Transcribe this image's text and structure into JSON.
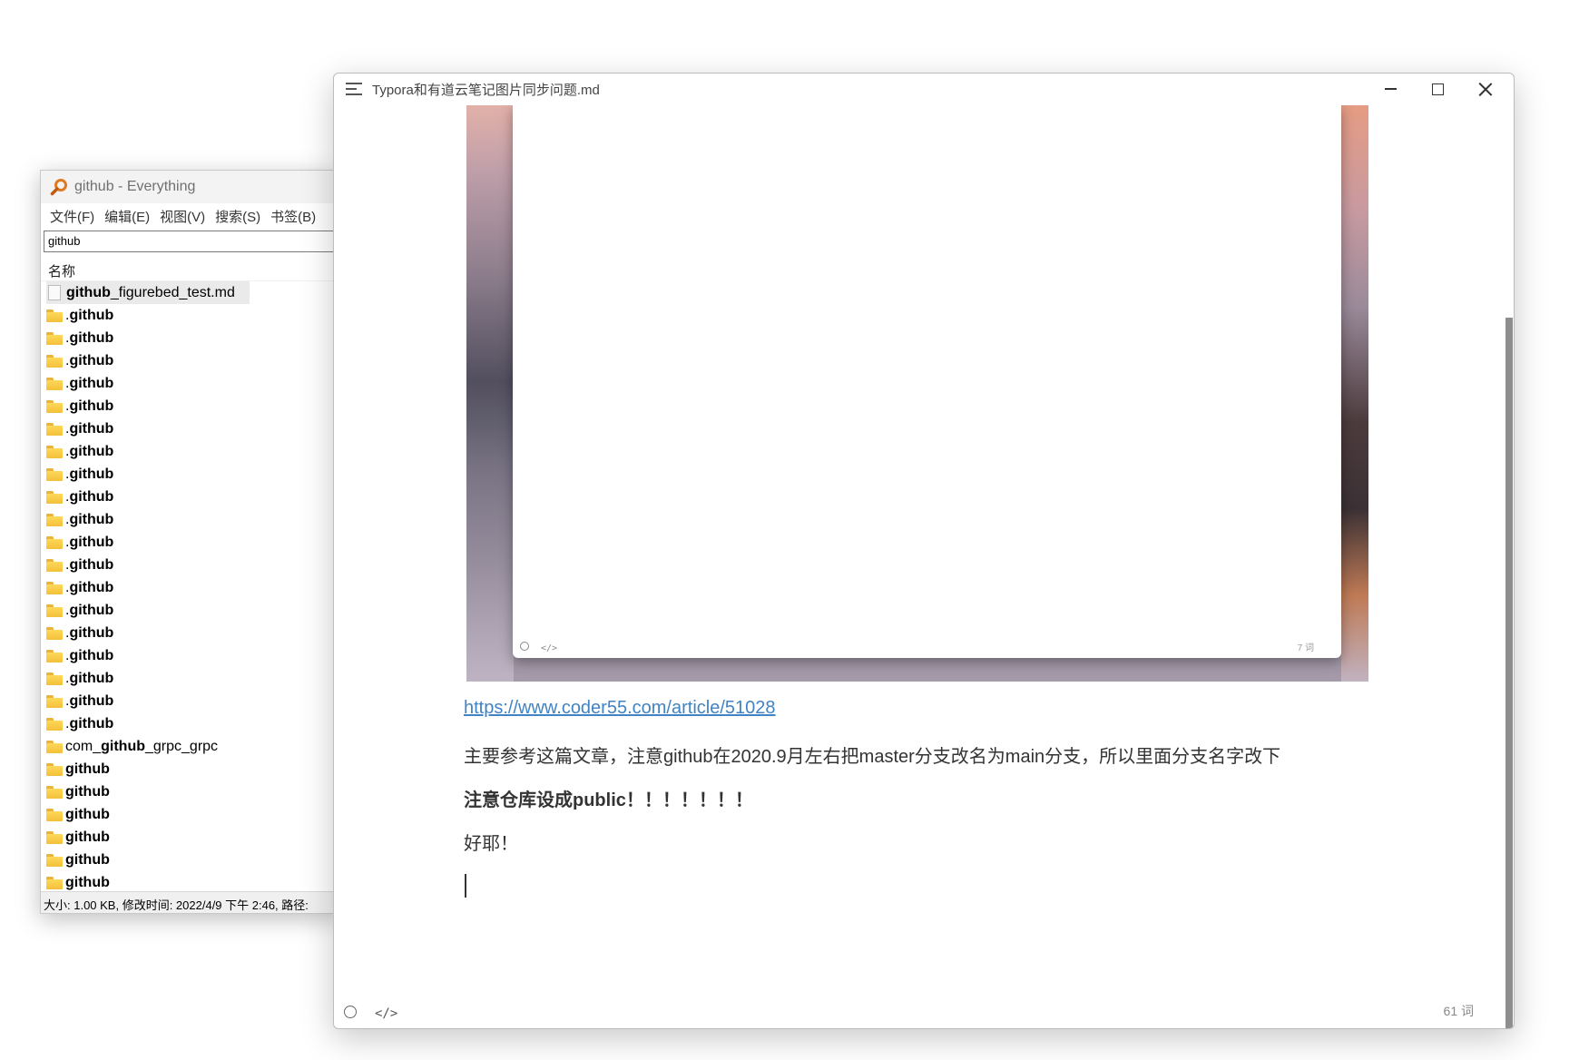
{
  "everything": {
    "title": "github - Everything",
    "menu": [
      "文件(F)",
      "编辑(E)",
      "视图(V)",
      "搜索(S)",
      "书签(B)"
    ],
    "search_value": "github",
    "column_name": "名称",
    "rows": [
      {
        "type": "md",
        "bold": "github",
        "rest": "_figurebed_test.md",
        "prefix": ""
      },
      {
        "type": "folder",
        "prefix": ".",
        "bold": "github",
        "rest": ""
      },
      {
        "type": "folder",
        "prefix": ".",
        "bold": "github",
        "rest": ""
      },
      {
        "type": "folder",
        "prefix": ".",
        "bold": "github",
        "rest": ""
      },
      {
        "type": "folder",
        "prefix": ".",
        "bold": "github",
        "rest": ""
      },
      {
        "type": "folder",
        "prefix": ".",
        "bold": "github",
        "rest": ""
      },
      {
        "type": "folder",
        "prefix": ".",
        "bold": "github",
        "rest": ""
      },
      {
        "type": "folder",
        "prefix": ".",
        "bold": "github",
        "rest": ""
      },
      {
        "type": "folder",
        "prefix": ".",
        "bold": "github",
        "rest": ""
      },
      {
        "type": "folder",
        "prefix": ".",
        "bold": "github",
        "rest": ""
      },
      {
        "type": "folder",
        "prefix": ".",
        "bold": "github",
        "rest": ""
      },
      {
        "type": "folder",
        "prefix": ".",
        "bold": "github",
        "rest": ""
      },
      {
        "type": "folder",
        "prefix": ".",
        "bold": "github",
        "rest": ""
      },
      {
        "type": "folder",
        "prefix": ".",
        "bold": "github",
        "rest": ""
      },
      {
        "type": "folder",
        "prefix": ".",
        "bold": "github",
        "rest": ""
      },
      {
        "type": "folder",
        "prefix": ".",
        "bold": "github",
        "rest": ""
      },
      {
        "type": "folder",
        "prefix": ".",
        "bold": "github",
        "rest": ""
      },
      {
        "type": "folder",
        "prefix": ".",
        "bold": "github",
        "rest": ""
      },
      {
        "type": "folder",
        "prefix": ".",
        "bold": "github",
        "rest": ""
      },
      {
        "type": "folder",
        "prefix": ".",
        "bold": "github",
        "rest": ""
      },
      {
        "type": "folder",
        "prefix": "com_",
        "bold": "github",
        "rest": "_grpc_grpc"
      },
      {
        "type": "folder",
        "prefix": "",
        "bold": "github",
        "rest": ""
      },
      {
        "type": "folder",
        "prefix": "",
        "bold": "github",
        "rest": ""
      },
      {
        "type": "folder",
        "prefix": "",
        "bold": "github",
        "rest": ""
      },
      {
        "type": "folder",
        "prefix": "",
        "bold": "github",
        "rest": ""
      },
      {
        "type": "folder",
        "prefix": "",
        "bold": "github",
        "rest": ""
      },
      {
        "type": "folder",
        "prefix": "",
        "bold": "github",
        "rest": ""
      }
    ],
    "status": "大小: 1.00 KB, 修改时间: 2022/4/9 下午 2:46, 路径:"
  },
  "typora": {
    "title": "Typora和有道云笔记图片同步问题.md",
    "embed_word_count": "7 词",
    "embed_code_icon": "</>",
    "link": "https://www.coder55.com/article/51028",
    "p1": "主要参考这篇文章，注意github在2020.9月左右把master分支改名为main分支，所以里面分支名字改下",
    "p2": "注意仓库设成public！！！！！！！",
    "p3": "好耶！",
    "code_icon": "</>",
    "word_count": "61 词"
  },
  "colors": {
    "link": "#4183c4",
    "folder": "#f3c03a",
    "everything_icon": "#e07a1f"
  }
}
